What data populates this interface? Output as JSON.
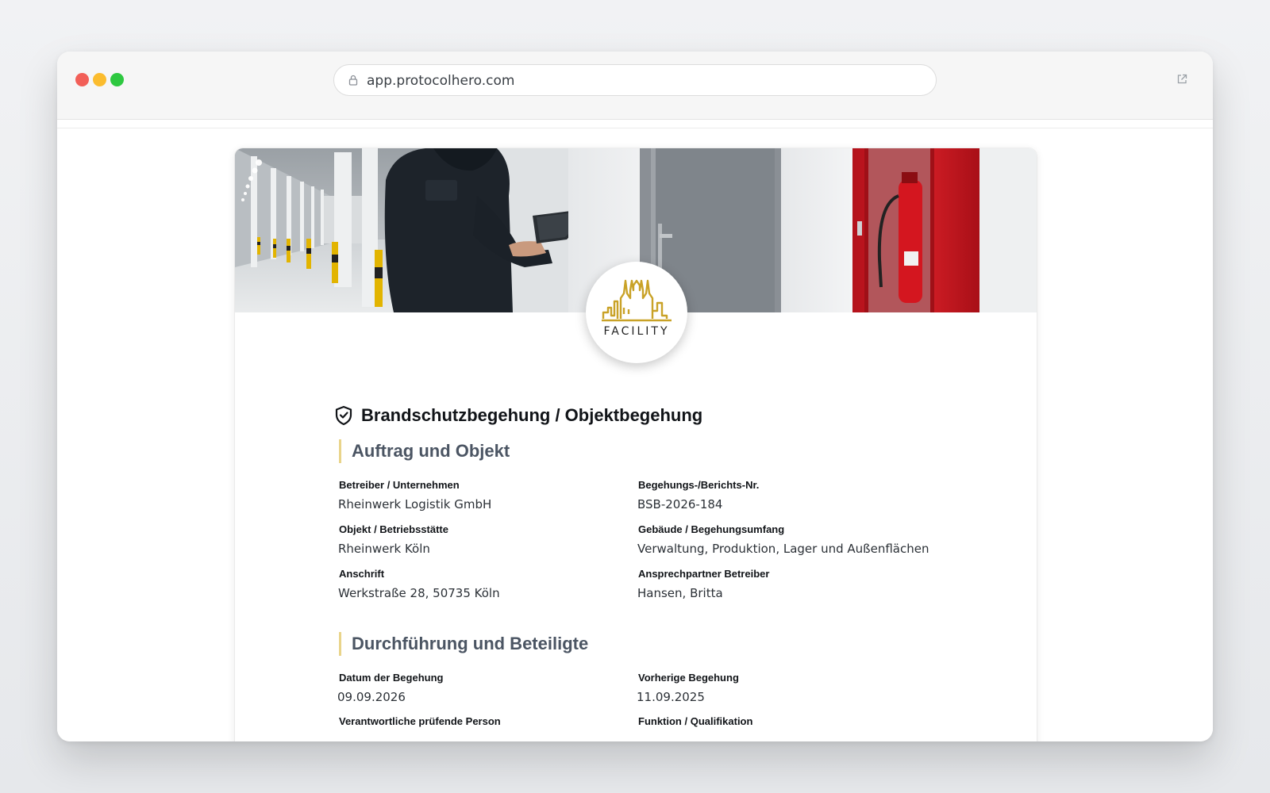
{
  "browser": {
    "url": "app.protocolhero.com"
  },
  "logo": {
    "wordmark": "FACILITY"
  },
  "document": {
    "title": "Brandschutzbegehung / Objektbegehung"
  },
  "sections": [
    {
      "heading": "Auftrag und Objekt",
      "fields": [
        {
          "label": "Betreiber / Unternehmen",
          "value": "Rheinwerk Logistik GmbH"
        },
        {
          "label": "Begehungs-/Berichts-Nr.",
          "value": "BSB-2026-184"
        },
        {
          "label": "Objekt / Betriebsstätte",
          "value": "Rheinwerk Köln"
        },
        {
          "label": "Gebäude / Begehungsumfang",
          "value": "Verwaltung, Produktion, Lager und Außenflächen"
        },
        {
          "label": "Anschrift",
          "value": "Werkstraße 28, 50735 Köln"
        },
        {
          "label": "Ansprechpartner Betreiber",
          "value": "Hansen, Britta"
        }
      ]
    },
    {
      "heading": "Durchführung und Beteiligte",
      "fields": [
        {
          "label": "Datum der Begehung",
          "value": "09.09.2026"
        },
        {
          "label": "Vorherige Begehung",
          "value": "11.09.2025"
        },
        {
          "label": "Verantwortliche prüfende Person",
          "value": ""
        },
        {
          "label": "Funktion / Qualifikation",
          "value": ""
        }
      ]
    }
  ],
  "colors": {
    "accent_bar": "#e9d48a",
    "logo_gold": "#c9a227",
    "section_heading": "#4b5563"
  }
}
